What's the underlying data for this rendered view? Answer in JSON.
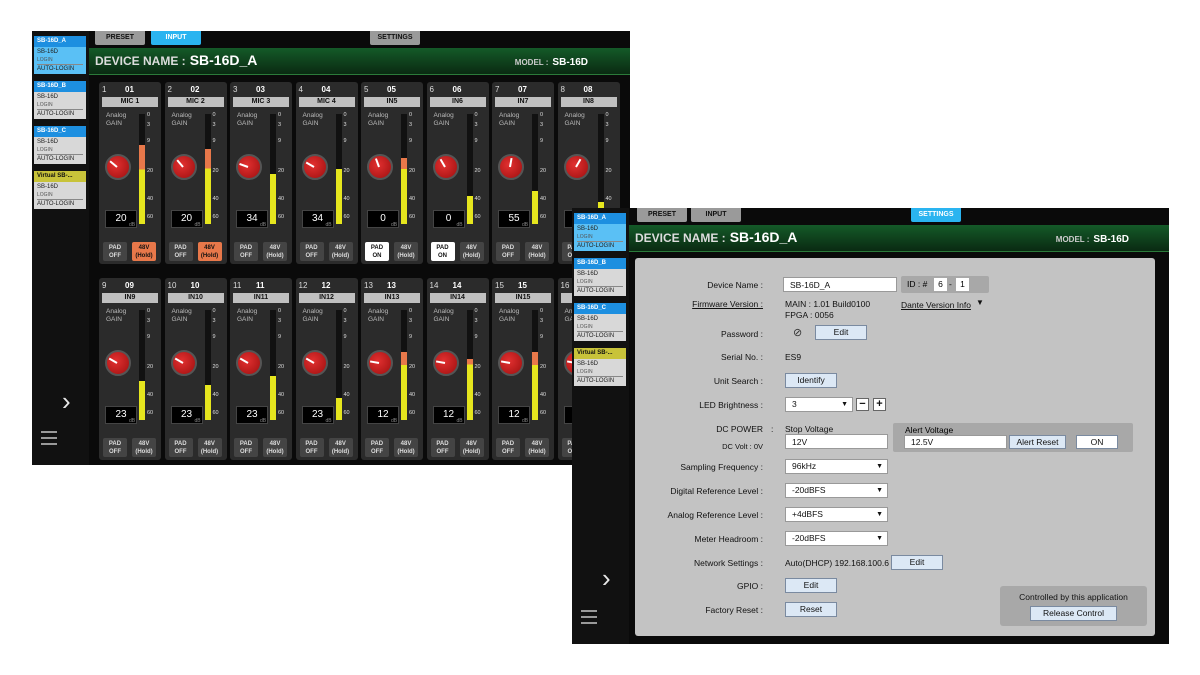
{
  "window1": {
    "tabs": [
      {
        "label": "PRESET"
      },
      {
        "label": "INPUT"
      },
      {
        "label": "SETTINGS"
      }
    ],
    "header": {
      "prefix": "DEVICE NAME :",
      "name": "SB-16D_A",
      "model_prefix": "MODEL :",
      "model": "SB-16D"
    },
    "devices": [
      {
        "name": "SB-16D_A",
        "model": "SB-16D",
        "status": "LOGIN",
        "mode": "AUTO-LOGIN"
      },
      {
        "name": "SB-16D_B",
        "model": "SB-16D",
        "status": "LOGIN",
        "mode": "AUTO-LOGIN"
      },
      {
        "name": "SB-16D_C",
        "model": "SB-16D",
        "status": "LOGIN",
        "mode": "AUTO-LOGIN"
      },
      {
        "name": "Virtual SB-...",
        "model": "SB-16D",
        "status": "LOGIN",
        "mode": "AUTO-LOGIN"
      }
    ],
    "channels": [
      {
        "num": "1",
        "ch": "01",
        "label": "MIC 1",
        "gain": "20",
        "level": 0.72,
        "pad": "off",
        "p48": "on"
      },
      {
        "num": "2",
        "ch": "02",
        "label": "MIC 2",
        "gain": "20",
        "level": 0.68,
        "pad": "off",
        "p48": "on"
      },
      {
        "num": "3",
        "ch": "03",
        "label": "MIC 3",
        "gain": "34",
        "level": 0.45,
        "pad": "off",
        "p48": "off"
      },
      {
        "num": "4",
        "ch": "04",
        "label": "MIC 4",
        "gain": "34",
        "level": 0.5,
        "pad": "off",
        "p48": "off"
      },
      {
        "num": "5",
        "ch": "05",
        "label": "IN5",
        "gain": "0",
        "level": 0.6,
        "pad": "on",
        "p48": "off"
      },
      {
        "num": "6",
        "ch": "06",
        "label": "IN6",
        "gain": "0",
        "level": 0.25,
        "pad": "on",
        "p48": "off"
      },
      {
        "num": "7",
        "ch": "07",
        "label": "IN7",
        "gain": "55",
        "level": 0.3,
        "pad": "off",
        "p48": "off"
      },
      {
        "num": "8",
        "ch": "08",
        "label": "IN8",
        "gain": "",
        "level": 0.2,
        "pad": "off",
        "p48": "off"
      },
      {
        "num": "9",
        "ch": "09",
        "label": "IN9",
        "gain": "23",
        "level": 0.35,
        "pad": "off",
        "p48": "off"
      },
      {
        "num": "10",
        "ch": "10",
        "label": "IN10",
        "gain": "23",
        "level": 0.32,
        "pad": "off",
        "p48": "off"
      },
      {
        "num": "11",
        "ch": "11",
        "label": "IN11",
        "gain": "23",
        "level": 0.4,
        "pad": "off",
        "p48": "off"
      },
      {
        "num": "12",
        "ch": "12",
        "label": "IN12",
        "gain": "23",
        "level": 0.2,
        "pad": "off",
        "p48": "off"
      },
      {
        "num": "13",
        "ch": "13",
        "label": "IN13",
        "gain": "12",
        "level": 0.62,
        "pad": "off",
        "p48": "off"
      },
      {
        "num": "14",
        "ch": "14",
        "label": "IN14",
        "gain": "12",
        "level": 0.55,
        "pad": "off",
        "p48": "off"
      },
      {
        "num": "15",
        "ch": "15",
        "label": "IN15",
        "gain": "12",
        "level": 0.62,
        "pad": "off",
        "p48": "off"
      },
      {
        "num": "16",
        "ch": "16",
        "label": "",
        "gain": "",
        "level": 0,
        "pad": "off",
        "p48": "off"
      }
    ],
    "strip_labels": {
      "analog": "Analog",
      "gain": "GAIN",
      "db": "dB",
      "pad": "PAD",
      "off": "OFF",
      "on": "ON",
      "p48": "48V",
      "hold": "(Hold)"
    },
    "scale": [
      "0",
      "3",
      "9",
      "20",
      "40",
      "60"
    ]
  },
  "window2": {
    "tabs": [
      {
        "label": "PRESET"
      },
      {
        "label": "INPUT"
      },
      {
        "label": "SETTINGS"
      }
    ],
    "header": {
      "prefix": "DEVICE NAME :",
      "name": "SB-16D_A",
      "model_prefix": "MODEL :",
      "model": "SB-16D"
    },
    "settings": {
      "device_name_label": "Device Name :",
      "device_name": "SB-16D_A",
      "id_label": "ID : #",
      "id_a": "6",
      "id_b": "1",
      "firmware_label": "Firmware Version :",
      "main": "MAIN :  1.01 Build0100",
      "fpga": "FPGA :   0056",
      "dante": "Dante Version Info",
      "password_label": "Password :",
      "edit": "Edit",
      "serial_label": "Serial No. :",
      "serial": "ES9",
      "unit_search_label": "Unit Search :",
      "identify": "Identify",
      "led_label": "LED Brightness :",
      "led": "3",
      "dc_power": "DC POWER",
      "dc_volt": "DC Volt : 0V",
      "stop_voltage": "Stop Voltage",
      "stop_value": "12V",
      "alert_voltage": "Alert Voltage",
      "alert_value": "12.5V",
      "alert_reset": "Alert Reset",
      "alert_on": "ON",
      "sampling_label": "Sampling Frequency :",
      "sampling": "96kHz",
      "digital_label": "Digital Reference Level :",
      "digital": "-20dBFS",
      "analog_label": "Analog Reference Level :",
      "analog": "+4dBFS",
      "headroom_label": "Meter Headroom :",
      "headroom": "-20dBFS",
      "network_label": "Network Settings :",
      "network": "Auto(DHCP) 192.168.100.6",
      "gpio_label": "GPIO :",
      "factory_label": "Factory Reset :",
      "reset": "Reset",
      "controlled": "Controlled by this application",
      "release": "Release Control"
    }
  },
  "colors": {
    "accent": "#2ab4f0",
    "header_green": "#145a28",
    "meter_yellow": "#e6e61e",
    "meter_orange": "#e8784a",
    "panel": "#c3c3c3"
  }
}
